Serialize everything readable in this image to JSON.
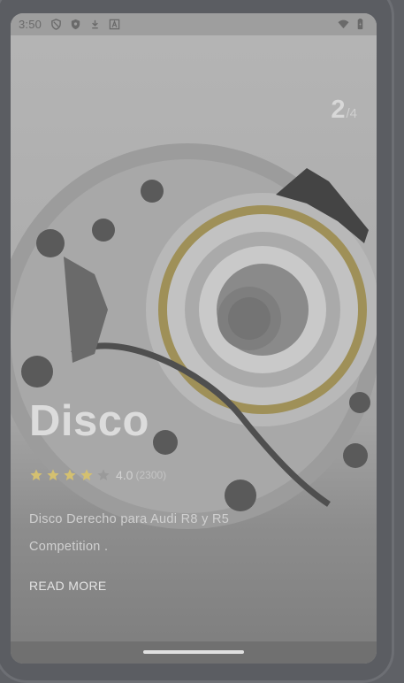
{
  "status_bar": {
    "time": "3:50",
    "icons": [
      "shield-outline-icon",
      "shield-filled-icon",
      "download-icon",
      "a-box-icon"
    ],
    "right_icons": [
      "wifi-icon",
      "battery-icon"
    ]
  },
  "carousel": {
    "current": "2",
    "total": "/4"
  },
  "product": {
    "title": "Disco",
    "rating_value": "4.0",
    "rating_count": "(2300)",
    "rating_stars": 4,
    "rating_max": 5,
    "description": "Disco Derecho para Audi R8 y R5 Competition .",
    "read_more_label": "READ MORE"
  },
  "colors": {
    "star_filled": "#d4c070",
    "star_empty": "#9a9a9a"
  }
}
